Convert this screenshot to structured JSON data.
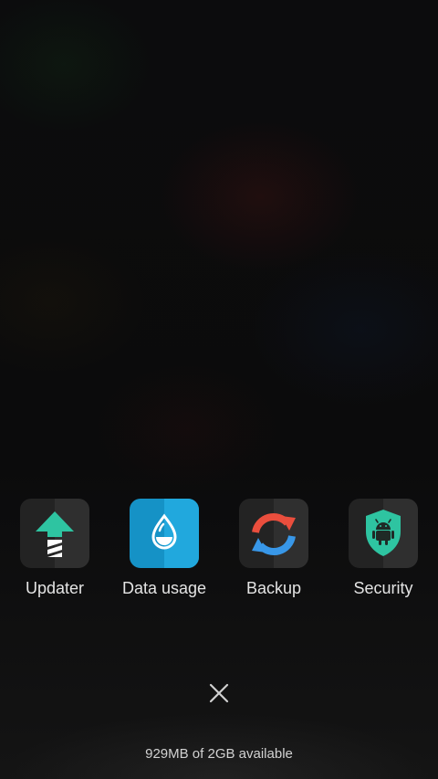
{
  "apps": [
    {
      "label": "Updater",
      "icon": "updater-arrow-icon",
      "color": "#2ec4a1"
    },
    {
      "label": "Data usage",
      "icon": "water-drop-icon",
      "color": "#1592c6"
    },
    {
      "label": "Backup",
      "icon": "sync-arrows-icon",
      "colors": [
        "#ea4e3d",
        "#3897e8"
      ]
    },
    {
      "label": "Security",
      "icon": "android-shield-icon",
      "color": "#2ec4a1"
    }
  ],
  "close_icon": "close-icon",
  "memory_status": "929MB of 2GB available"
}
